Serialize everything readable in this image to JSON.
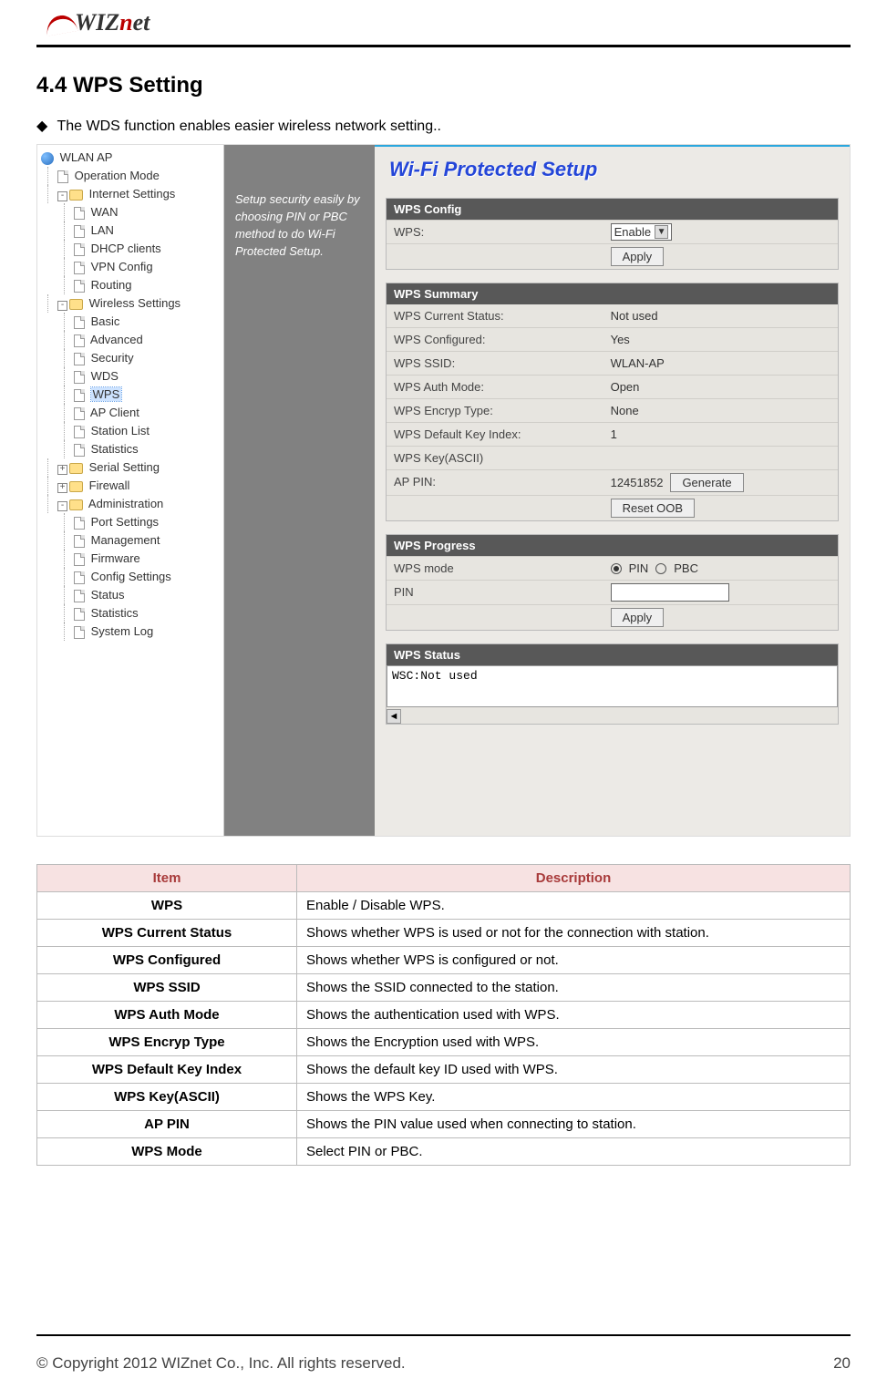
{
  "logo_text": "WIZnet",
  "section_title": "4.4  WPS Setting",
  "lead_bullet": "◆",
  "lead_text": "The WDS function enables easier wireless network setting..",
  "tree": {
    "root_icon": "world",
    "root": "WLAN AP",
    "items": [
      {
        "icon": "page",
        "label": "Operation Mode",
        "indent": "vline"
      },
      {
        "icon": "fold",
        "label": "Internet Settings",
        "indent": "vline",
        "expander": "-"
      },
      {
        "icon": "page",
        "label": "WAN",
        "indent": "vline2"
      },
      {
        "icon": "page",
        "label": "LAN",
        "indent": "vline2"
      },
      {
        "icon": "page",
        "label": "DHCP clients",
        "indent": "vline2"
      },
      {
        "icon": "page",
        "label": "VPN Config",
        "indent": "vline2"
      },
      {
        "icon": "page",
        "label": "Routing",
        "indent": "vline2"
      },
      {
        "icon": "fold",
        "label": "Wireless Settings",
        "indent": "vline",
        "expander": "-"
      },
      {
        "icon": "page",
        "label": "Basic",
        "indent": "vline2"
      },
      {
        "icon": "page",
        "label": "Advanced",
        "indent": "vline2"
      },
      {
        "icon": "page",
        "label": "Security",
        "indent": "vline2"
      },
      {
        "icon": "page",
        "label": "WDS",
        "indent": "vline2"
      },
      {
        "icon": "page",
        "label": "WPS",
        "indent": "vline2",
        "selected": true
      },
      {
        "icon": "page",
        "label": "AP Client",
        "indent": "vline2"
      },
      {
        "icon": "page",
        "label": "Station List",
        "indent": "vline2"
      },
      {
        "icon": "page",
        "label": "Statistics",
        "indent": "vline2"
      },
      {
        "icon": "fold",
        "label": "Serial Setting",
        "indent": "vline",
        "expander": "+"
      },
      {
        "icon": "fold",
        "label": "Firewall",
        "indent": "vline",
        "expander": "+"
      },
      {
        "icon": "fold",
        "label": "Administration",
        "indent": "vline",
        "expander": "-"
      },
      {
        "icon": "page",
        "label": "Port Settings",
        "indent": "vline2"
      },
      {
        "icon": "page",
        "label": "Management",
        "indent": "vline2"
      },
      {
        "icon": "page",
        "label": "Firmware",
        "indent": "vline2"
      },
      {
        "icon": "page",
        "label": "Config Settings",
        "indent": "vline2"
      },
      {
        "icon": "page",
        "label": "Status",
        "indent": "vline2"
      },
      {
        "icon": "page",
        "label": "Statistics",
        "indent": "vline2"
      },
      {
        "icon": "page",
        "label": "System Log",
        "indent": "vline2"
      }
    ]
  },
  "tip_text": "Setup security easily by choosing PIN or PBC method to do Wi-Fi Protected Setup.",
  "main": {
    "title": "Wi-Fi Protected Setup",
    "wps_config": {
      "header": "WPS Config",
      "label": "WPS:",
      "select_value": "Enable",
      "apply": "Apply"
    },
    "wps_summary": {
      "header": "WPS Summary",
      "rows": [
        {
          "k": "WPS Current Status:",
          "v": "Not used"
        },
        {
          "k": "WPS Configured:",
          "v": "Yes"
        },
        {
          "k": "WPS SSID:",
          "v": "WLAN-AP"
        },
        {
          "k": "WPS Auth Mode:",
          "v": "Open"
        },
        {
          "k": "WPS Encryp Type:",
          "v": "None"
        },
        {
          "k": "WPS Default Key Index:",
          "v": "1"
        },
        {
          "k": "WPS Key(ASCII)",
          "v": ""
        }
      ],
      "ap_pin_label": "AP PIN:",
      "ap_pin_value": "12451852",
      "generate": "Generate",
      "reset": "Reset OOB"
    },
    "wps_progress": {
      "header": "WPS Progress",
      "mode_label": "WPS mode",
      "pin_radio": "PIN",
      "pbc_radio": "PBC",
      "pin_label": "PIN",
      "apply": "Apply"
    },
    "wps_status": {
      "header": "WPS Status",
      "text": "WSC:Not used"
    }
  },
  "desc_table": {
    "head_item": "Item",
    "head_desc": "Description",
    "rows": [
      {
        "k": "WPS",
        "v": "Enable / Disable WPS."
      },
      {
        "k": "WPS Current Status",
        "v": "Shows whether WPS is used or not for the connection with station."
      },
      {
        "k": "WPS Configured",
        "v": "Shows whether WPS is configured or not."
      },
      {
        "k": "WPS SSID",
        "v": "Shows the SSID connected to the station."
      },
      {
        "k": "WPS Auth Mode",
        "v": "Shows the authentication used with WPS."
      },
      {
        "k": "WPS Encryp Type",
        "v": "Shows the Encryption used with WPS."
      },
      {
        "k": "WPS Default Key Index",
        "v": "Shows the default key ID used with WPS."
      },
      {
        "k": "WPS Key(ASCII)",
        "v": "Shows the WPS Key."
      },
      {
        "k": "AP PIN",
        "v": "Shows the PIN value used when connecting to station."
      },
      {
        "k": "WPS Mode",
        "v": "Select PIN or PBC."
      }
    ]
  },
  "footer_left": "© Copyright 2012 WIZnet Co., Inc. All rights reserved.",
  "footer_right": "20"
}
